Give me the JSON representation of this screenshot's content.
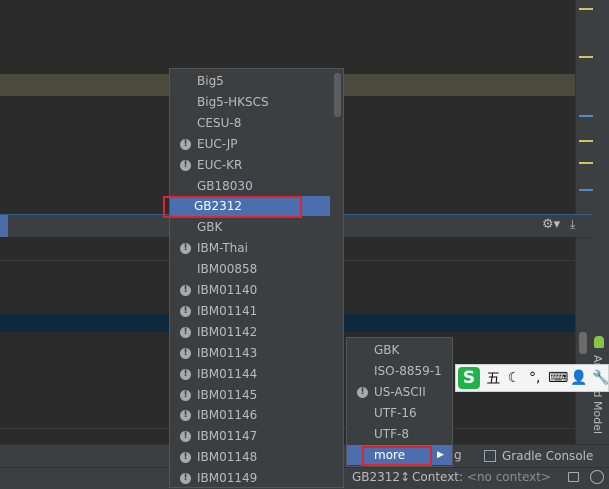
{
  "encoding_menu": {
    "items": [
      {
        "label": "Big5",
        "warning": false
      },
      {
        "label": "Big5-HKSCS",
        "warning": false
      },
      {
        "label": "CESU-8",
        "warning": false
      },
      {
        "label": "EUC-JP",
        "warning": true
      },
      {
        "label": "EUC-KR",
        "warning": true
      },
      {
        "label": "GB18030",
        "warning": false
      },
      {
        "label": "GB2312",
        "warning": false,
        "selected": true
      },
      {
        "label": "GBK",
        "warning": false
      },
      {
        "label": "IBM-Thai",
        "warning": true
      },
      {
        "label": "IBM00858",
        "warning": false
      },
      {
        "label": "IBM01140",
        "warning": true
      },
      {
        "label": "IBM01141",
        "warning": true
      },
      {
        "label": "IBM01142",
        "warning": true
      },
      {
        "label": "IBM01143",
        "warning": true
      },
      {
        "label": "IBM01144",
        "warning": true
      },
      {
        "label": "IBM01145",
        "warning": true
      },
      {
        "label": "IBM01146",
        "warning": true
      },
      {
        "label": "IBM01147",
        "warning": true
      },
      {
        "label": "IBM01148",
        "warning": true
      },
      {
        "label": "IBM01149",
        "warning": true
      }
    ]
  },
  "submenu": {
    "items": [
      {
        "label": "GBK",
        "warning": false
      },
      {
        "label": "ISO-8859-1",
        "warning": false
      },
      {
        "label": "US-ASCII",
        "warning": true
      },
      {
        "label": "UTF-16",
        "warning": false
      },
      {
        "label": "UTF-8",
        "warning": false
      }
    ],
    "more_label": "more"
  },
  "tool_tabs": {
    "partial_label": "g",
    "gradle_console": "Gradle Console"
  },
  "status_bar": {
    "encoding": "GB2312↕",
    "context_label": "Context:",
    "context_value": "<no context>"
  },
  "right_panel": {
    "vertical_label": "Android Model"
  },
  "ime_toolbar": {
    "logo": "S",
    "buttons": [
      "五",
      "☾",
      "°,",
      "⌨",
      "👤",
      "🔧"
    ]
  },
  "colors": {
    "selection": "#4b6eaf",
    "highlight_box": "#e0242b",
    "ime_logo": "#21b24b"
  }
}
